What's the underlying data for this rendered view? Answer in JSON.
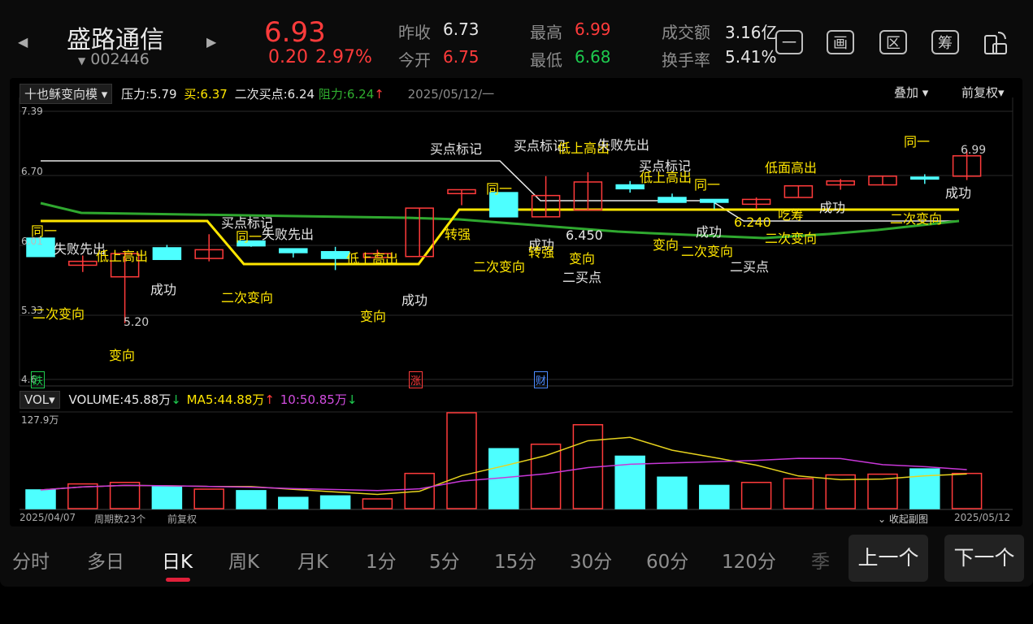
{
  "header": {
    "stock_name": "盛路通信",
    "stock_code": "002446",
    "price": "6.93",
    "change": "0.20",
    "change_pct": "2.97%",
    "prev_close_label": "昨收",
    "prev_close": "6.73",
    "open_label": "今开",
    "open": "6.75",
    "high_label": "最高",
    "high": "6.99",
    "low_label": "最低",
    "low": "6.68",
    "amount_label": "成交额",
    "amount": "3.16亿",
    "turnover_label": "换手率",
    "turnover": "5.41%",
    "tools": [
      "一",
      "画",
      "区",
      "筹"
    ]
  },
  "main_chart": {
    "indicator": "十也稣变向模",
    "pressure": "压力:5.79",
    "buy": "买:6.37",
    "second_buy": "二次买点:6.24",
    "resistance": "阻力:6.24",
    "date": "2025/05/12/一",
    "overlay_label": "叠加",
    "adjust_label": "前复权",
    "y_ticks": [
      "7.39",
      "6.70",
      "6.01",
      "5.33",
      "4.6"
    ],
    "markers": [
      "跌",
      "涨",
      "财"
    ],
    "high_label": "6.99",
    "low_label": "5.20"
  },
  "vol_chart": {
    "indicator": "VOL",
    "volume": "VOLUME:45.88万",
    "ma5": "MA5:44.88万",
    "ma10": "10:50.85万",
    "max_label": "127.9万",
    "start_date": "2025/04/07",
    "period_count": "周期数23个",
    "adjust": "前复权",
    "collapse": "收起副图",
    "end_date": "2025/05/12"
  },
  "colors": {
    "up": "#ff3b3b",
    "down": "#4dffff",
    "yellow": "#ffe600",
    "green": "#2fa82f",
    "purple": "#c837d8",
    "accent": "#e0203a"
  },
  "candles": [
    {
      "o": 6.08,
      "c": 5.89,
      "h": 6.1,
      "l": 5.89
    },
    {
      "o": 5.8,
      "c": 5.84,
      "h": 5.9,
      "l": 5.73
    },
    {
      "o": 5.68,
      "c": 5.92,
      "h": 5.95,
      "l": 5.2
    },
    {
      "o": 5.98,
      "c": 5.86,
      "h": 6.01,
      "l": 5.86
    },
    {
      "o": 5.87,
      "c": 5.96,
      "h": 6.12,
      "l": 5.84
    },
    {
      "o": 6.05,
      "c": 6.0,
      "h": 6.05,
      "l": 5.99
    },
    {
      "o": 5.97,
      "c": 5.93,
      "h": 5.97,
      "l": 5.88
    },
    {
      "o": 5.94,
      "c": 5.87,
      "h": 5.99,
      "l": 5.75
    },
    {
      "o": 5.88,
      "c": 5.92,
      "h": 5.96,
      "l": 5.88
    },
    {
      "o": 5.89,
      "c": 6.39,
      "h": 6.39,
      "l": 5.89
    },
    {
      "o": 6.54,
      "c": 6.58,
      "h": 6.58,
      "l": 6.42
    },
    {
      "o": 6.55,
      "c": 6.3,
      "h": 6.55,
      "l": 6.3
    },
    {
      "o": 6.3,
      "c": 6.52,
      "h": 6.72,
      "l": 6.3
    },
    {
      "o": 6.37,
      "c": 6.66,
      "h": 6.76,
      "l": 6.37
    },
    {
      "o": 6.63,
      "c": 6.59,
      "h": 6.67,
      "l": 6.55
    },
    {
      "o": 6.5,
      "c": 6.45,
      "h": 6.54,
      "l": 6.45
    },
    {
      "o": 6.48,
      "c": 6.45,
      "h": 6.48,
      "l": 6.38
    },
    {
      "o": 6.43,
      "c": 6.48,
      "h": 6.5,
      "l": 6.38
    },
    {
      "o": 6.5,
      "c": 6.62,
      "h": 6.62,
      "l": 6.5
    },
    {
      "o": 6.63,
      "c": 6.67,
      "h": 6.69,
      "l": 6.58
    },
    {
      "o": 6.63,
      "c": 6.72,
      "h": 6.72,
      "l": 6.63
    },
    {
      "o": 6.71,
      "c": 6.69,
      "h": 6.74,
      "l": 6.64
    },
    {
      "o": 6.72,
      "c": 6.93,
      "h": 6.99,
      "l": 6.68
    }
  ],
  "volumes": [
    25,
    33,
    35,
    29,
    26,
    24,
    15,
    17,
    13,
    47,
    128,
    80,
    86,
    112,
    70,
    42,
    31,
    35,
    40,
    45,
    46,
    53,
    47
  ],
  "tabs": [
    "分时",
    "多日",
    "日K",
    "周K",
    "月K",
    "1分",
    "5分",
    "15分",
    "30分",
    "60分",
    "120分",
    "季"
  ],
  "active_tab": "日K",
  "prev_button": "上一个",
  "next_button": "下一个",
  "signals": [
    {
      "t": "同一",
      "c": "yel"
    },
    {
      "t": "失败先出",
      "c": "white"
    },
    {
      "t": "低上高出",
      "c": "yel"
    },
    {
      "t": "二次变向",
      "c": "yel"
    },
    {
      "t": "变向",
      "c": "yel"
    },
    {
      "t": "成功",
      "c": "white"
    },
    {
      "t": "买点标记",
      "c": "white"
    },
    {
      "t": "同一",
      "c": "yel"
    },
    {
      "t": "失败先出",
      "c": "white"
    },
    {
      "t": "二次变向",
      "c": "yel"
    },
    {
      "t": "低上高出",
      "c": "yel"
    },
    {
      "t": "变向",
      "c": "yel"
    },
    {
      "t": "成功",
      "c": "white"
    },
    {
      "t": "买点标记",
      "c": "white"
    },
    {
      "t": "转强",
      "c": "yel"
    },
    {
      "t": "同一",
      "c": "yel"
    },
    {
      "t": "二次变向",
      "c": "yel"
    },
    {
      "t": "买点标记",
      "c": "white"
    },
    {
      "t": "成功",
      "c": "white"
    },
    {
      "t": "转强",
      "c": "yel"
    },
    {
      "t": "低上高出",
      "c": "yel"
    },
    {
      "t": "失败先出",
      "c": "white"
    },
    {
      "t": "6.450",
      "c": "white"
    },
    {
      "t": "变向",
      "c": "yel"
    },
    {
      "t": "二买点",
      "c": "white"
    },
    {
      "t": "买点标记",
      "c": "white"
    },
    {
      "t": "低上高出",
      "c": "yel"
    },
    {
      "t": "变向",
      "c": "yel"
    },
    {
      "t": "同一",
      "c": "yel"
    },
    {
      "t": "成功",
      "c": "white"
    },
    {
      "t": "二次变向",
      "c": "yel"
    },
    {
      "t": "6.240",
      "c": "yel"
    },
    {
      "t": "二买点",
      "c": "white"
    },
    {
      "t": "低面高出",
      "c": "yel"
    },
    {
      "t": "吃筹",
      "c": "yel"
    },
    {
      "t": "二次变向",
      "c": "yel"
    },
    {
      "t": "成功",
      "c": "white"
    },
    {
      "t": "同一",
      "c": "yel"
    },
    {
      "t": "二次变向",
      "c": "yel"
    },
    {
      "t": "成功",
      "c": "white"
    }
  ]
}
